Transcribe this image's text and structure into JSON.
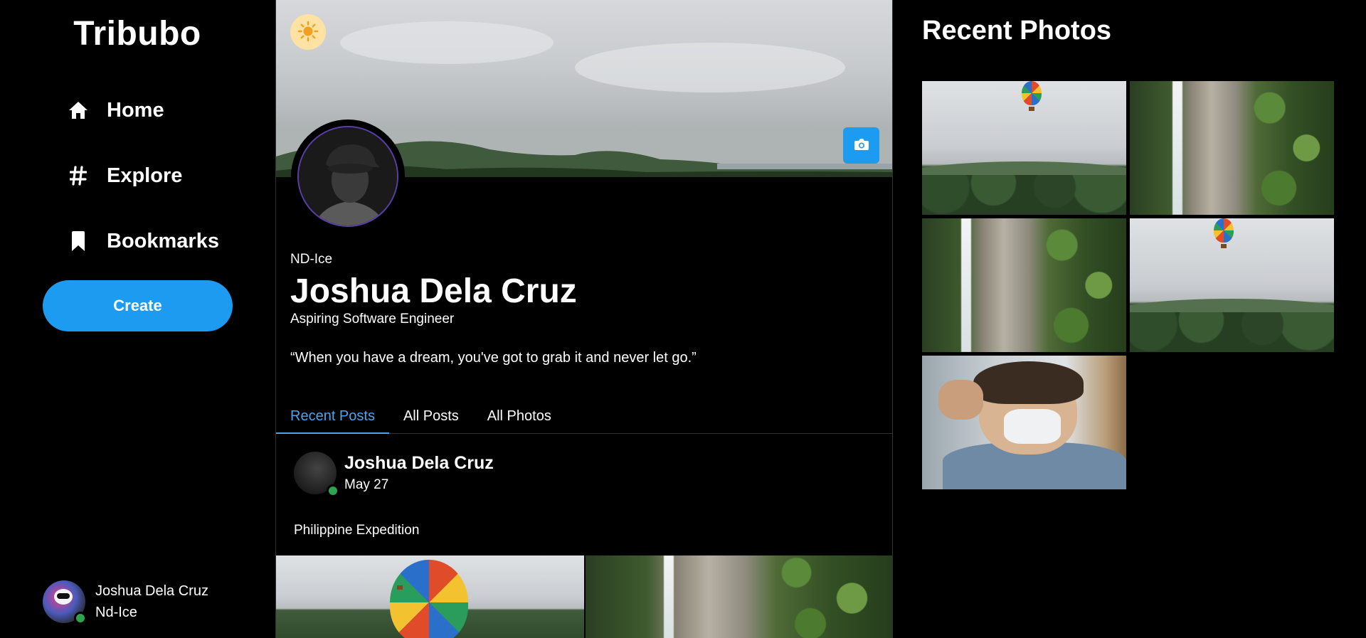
{
  "app": {
    "brand": "Tribubo"
  },
  "nav": {
    "items": [
      {
        "label": "Home",
        "icon": "home-icon"
      },
      {
        "label": "Explore",
        "icon": "hash-icon"
      },
      {
        "label": "Bookmarks",
        "icon": "bookmark-icon"
      }
    ],
    "create_label": "Create"
  },
  "account": {
    "name": "Joshua Dela Cruz",
    "handle": "Nd-Ice",
    "status": "online"
  },
  "profile": {
    "handle": "ND-Ice",
    "name": "Joshua Dela Cruz",
    "bio": "Aspiring Software Engineer",
    "quote": "“When you have a dream, you've got to grab it and never let go.”"
  },
  "tabs": [
    {
      "label": "Recent Posts",
      "active": true
    },
    {
      "label": "All Posts",
      "active": false
    },
    {
      "label": "All Photos",
      "active": false
    }
  ],
  "post": {
    "author": "Joshua Dela Cruz",
    "date": "May 27",
    "text": "Philippine Expedition",
    "images": [
      "balloon-landscape",
      "waterfall"
    ]
  },
  "photos_panel": {
    "title": "Recent Photos",
    "photos": [
      "balloon-landscape",
      "waterfall",
      "waterfall",
      "balloon-landscape",
      "selfie-with-mask"
    ]
  },
  "colors": {
    "accent": "#1d9bf0",
    "active_tab": "#4aa5f0",
    "online": "#2ea44f",
    "theme_toggle": "#fde2a3"
  }
}
